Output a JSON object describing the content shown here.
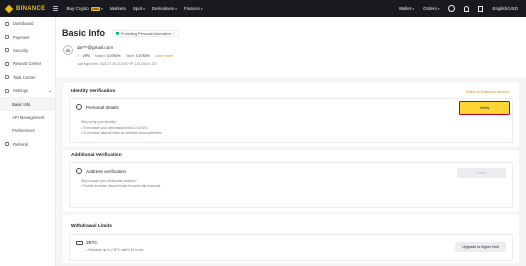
{
  "nav": {
    "logo": "BINANCE",
    "items": [
      {
        "label": "Buy Crypto",
        "badge": "USD",
        "caret": true
      },
      {
        "label": "Markets",
        "caret": false
      },
      {
        "label": "Spot",
        "caret": true
      },
      {
        "label": "Derivatives",
        "caret": true
      },
      {
        "label": "Finance",
        "caret": true
      }
    ],
    "wallet": "Wallet",
    "orders": "Orders",
    "language": "English/USD"
  },
  "sidebar": {
    "items": [
      {
        "label": "Dashboard",
        "icon": "dashboard-icon"
      },
      {
        "label": "Payment",
        "icon": "payment-icon"
      },
      {
        "label": "Security",
        "icon": "security-icon"
      },
      {
        "label": "Reward Center",
        "icon": "reward-icon"
      },
      {
        "label": "Task Center",
        "icon": "task-icon"
      },
      {
        "label": "Settings",
        "icon": "settings-icon",
        "caret": true
      },
      {
        "label": "Basic Info",
        "sub": true,
        "active": true
      },
      {
        "label": "API Management",
        "sub": true
      },
      {
        "label": "Preferences",
        "sub": true
      },
      {
        "label": "Referral",
        "icon": "referral-icon"
      }
    ]
  },
  "header": {
    "title": "Basic Info",
    "protect_link": "Protecting Personal Information",
    "avatar_initials": "da",
    "email": "da***@gmail.com",
    "verified_label": "VIP0",
    "maker_label": "Maker:",
    "maker_value": "0.0750%",
    "taker_label": "Taker:",
    "taker_value": "0.0750%",
    "learn_more": "Learn more",
    "last_login": "Last login time: 2023-07-29 12:34:57 IP: 178.136.97.221"
  },
  "identity": {
    "title": "Identity Verification",
    "link": "Switch to Enterprise account",
    "item_title": "Personal details",
    "why_text": "Why verify your identity?",
    "bullet1": "• To increase your withdrawal limit to 100 BTC",
    "bullet2": "• To increase deposit limits for selected local currencies",
    "verify_label": "Verify"
  },
  "additional": {
    "title": "Additional Verification",
    "item_title": "Address verification",
    "why_text": "Why include your residential address?",
    "bullet1": "• Further increase deposit limits for some fiat channels",
    "verify_label": "Verify"
  },
  "limits": {
    "title": "Withdrawal Limits",
    "amount": "2BTC",
    "note": "• Withdraw up to 2 BTC within 24 hours",
    "upgrade_label": "Upgrade to higher limit"
  },
  "colors": {
    "accent": "#f0b90b",
    "verify_button": "#fcd535",
    "highlight_border": "#c0001a",
    "nav_bg": "#181a20"
  }
}
